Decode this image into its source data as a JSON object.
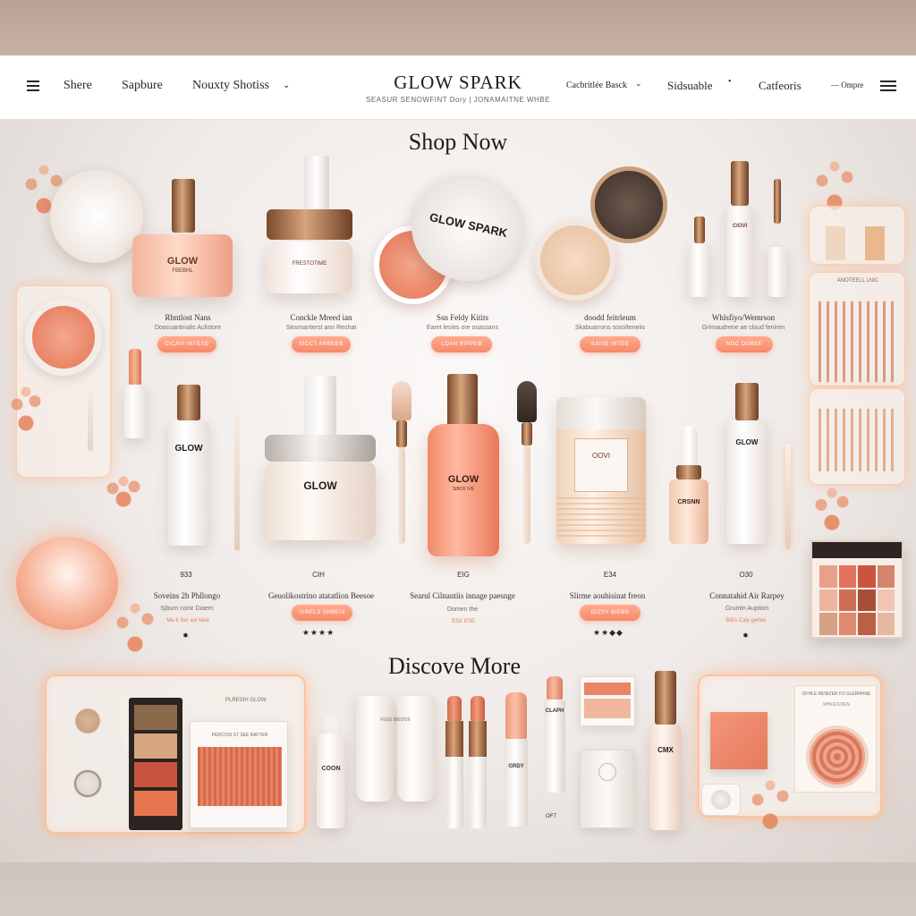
{
  "header": {
    "nav_left": [
      "Shere",
      "Sapbure",
      "Nouxty  Shotiss"
    ],
    "brand_name": "GLOW SPARK",
    "brand_tagline": "SEASUR SENOWFINT Dory  |  JONAMAITNE WHBE",
    "nav_right": [
      "Cacbritlée Basck",
      "Sidsuable",
      "Catfeoris",
      "Ompre"
    ]
  },
  "sections": {
    "shop_title": "Shop Now",
    "discover_title": "Discove More"
  },
  "row1": [
    {
      "name": "Rbntlost Nans",
      "sub": "Doocuantinalis Aclistore",
      "button": "CICAVI  INTESE"
    },
    {
      "name": "Conckle Mreed ian",
      "sub": "Sinsmanterst ann Reshat",
      "button": "SICCT  ARBEEB"
    },
    {
      "name": "Ssn Feldy Kitits",
      "sub": "Earet lesies ore osassans",
      "button": "LOAN  RIPPEB"
    },
    {
      "name": "doodd feitrleum",
      "sub": "Skabuarrons sosolteneiis",
      "button": "SAISE  INTEE"
    },
    {
      "name": "Whlsfiyo/Wemrson",
      "sub": "Grimaudrene ae cloud feniren",
      "button": "NOC  DOBEE"
    }
  ],
  "row1_labels": {
    "jar1": "GLOW",
    "jar1_sub": "FBEBHL",
    "jar2": "FRESTOTIME",
    "compact": "GLOW SPARK",
    "bottle_right": "CIOVI"
  },
  "row2": [
    {
      "price": "933",
      "name": "Soveins  2b Phllongo",
      "sub": "Sjburn conir Diaem",
      "rating": "Ma 6 Ser aol Idea"
    },
    {
      "price": "CIH",
      "name": "Geuolikostrino atatatlion Beesoe",
      "button": "UIRELS  SHBEIX",
      "stars": "★★★★"
    },
    {
      "price": "EIG",
      "name": "Searul Cilnantiis innage paesnge",
      "sub": "Domen the",
      "rating": "ESX  ESE"
    },
    {
      "price": "E34",
      "name": "Slirme aouhisinat freon",
      "button": "GIZSY  BIEBS",
      "stars": "★★◆◆"
    },
    {
      "price": "O30",
      "name": "Connatahid Air Rarpey",
      "sub": "Gruntin Auption",
      "rating": "BIEs  Caly  gertee"
    }
  ],
  "row2_labels": {
    "tall_bottle": "GLOW",
    "jar": "GLOW",
    "pump": "GLOW",
    "pump_sub": "SIBCK  IVE",
    "square_jar": "OOVI",
    "dropper": "CRSNN",
    "tall_right": "GLOW"
  },
  "discover": {
    "palette_title": "PLRESIH GLOW",
    "palette_card": "PERCOSI  ST SEE  BAFTER",
    "tubes_label": "FIGIS  BIEOOX",
    "tube_left": "COON",
    "lipstick_label": "CLAPH",
    "gloss_label": "GRDY",
    "lip_tag": "OFT",
    "bottle_label": "CMX",
    "right_panel_title": "OFHLE  RENIZER  FO  SLERRHNE",
    "right_panel_sub": "WHEESIXEN"
  },
  "side_panel": {
    "title": "ANOTEELL LNIC"
  },
  "colors": {
    "accent": "#f6896a",
    "peach": "#f4a88e",
    "gold": "#c8936a",
    "text_dark": "#1e1a17"
  },
  "icons": [
    "menu-icon",
    "chevron-down-icon",
    "sparkle-icon"
  ]
}
